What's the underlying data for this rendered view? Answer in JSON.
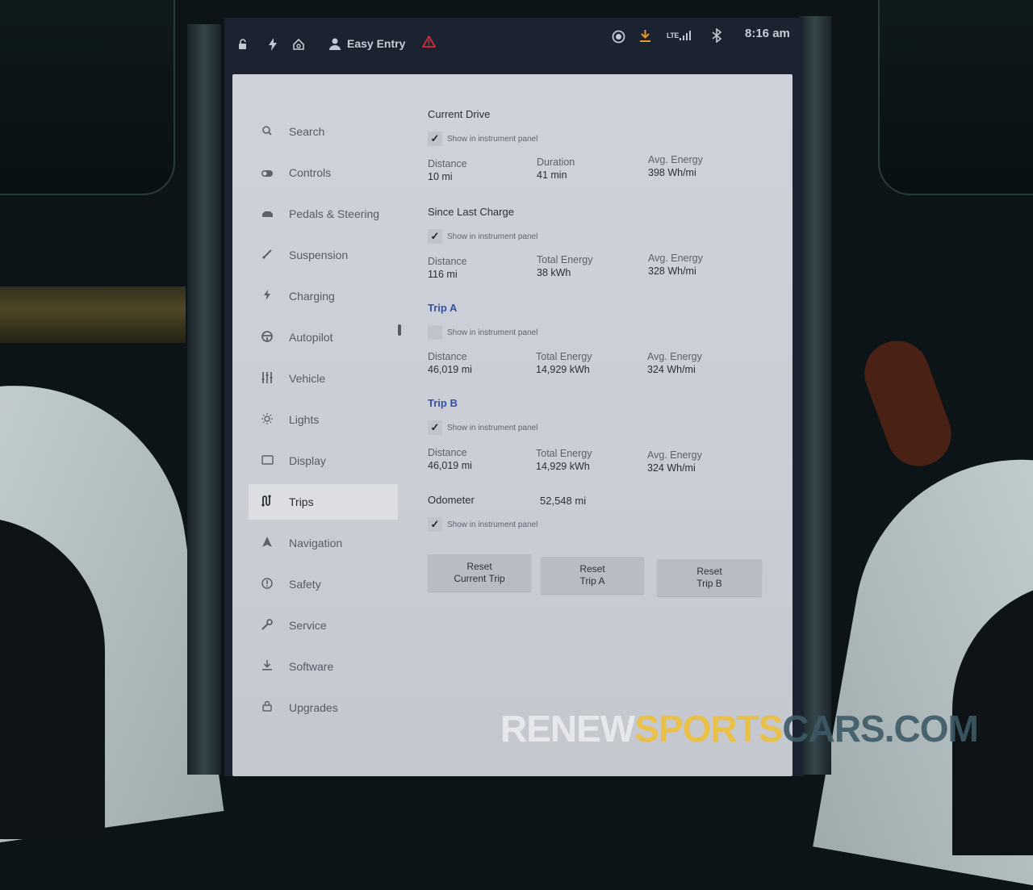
{
  "status_bar": {
    "profile_name": "Easy Entry",
    "time": "8:16 am",
    "network": "LTE",
    "icons": [
      "lock-open-icon",
      "lightning-icon",
      "homelink-icon",
      "person-icon",
      "warning-icon",
      "camera-record-icon",
      "download-icon",
      "lte-signal-icon",
      "bluetooth-icon"
    ]
  },
  "sidebar": {
    "items": [
      {
        "label": "Search",
        "icon": "search-icon"
      },
      {
        "label": "Controls",
        "icon": "toggle-icon"
      },
      {
        "label": "Pedals & Steering",
        "icon": "car-icon"
      },
      {
        "label": "Suspension",
        "icon": "suspension-icon"
      },
      {
        "label": "Charging",
        "icon": "lightning-icon"
      },
      {
        "label": "Autopilot",
        "icon": "steering-wheel-icon"
      },
      {
        "label": "Vehicle",
        "icon": "sliders-icon"
      },
      {
        "label": "Lights",
        "icon": "sun-icon"
      },
      {
        "label": "Display",
        "icon": "display-icon"
      },
      {
        "label": "Trips",
        "icon": "trips-icon"
      },
      {
        "label": "Navigation",
        "icon": "navigation-icon"
      },
      {
        "label": "Safety",
        "icon": "alert-circle-icon"
      },
      {
        "label": "Service",
        "icon": "wrench-icon"
      },
      {
        "label": "Software",
        "icon": "download-icon"
      },
      {
        "label": "Upgrades",
        "icon": "bag-icon"
      }
    ],
    "active": "Trips"
  },
  "trips": {
    "show_in_panel_label": "Show in instrument panel",
    "current_drive": {
      "title": "Current Drive",
      "show_in_panel": true,
      "stats": [
        {
          "label": "Distance",
          "value": "10 mi"
        },
        {
          "label": "Duration",
          "value": "41 min"
        },
        {
          "label": "Avg. Energy",
          "value": "398 Wh/mi"
        }
      ]
    },
    "since_last_charge": {
      "title": "Since Last Charge",
      "show_in_panel": true,
      "stats": [
        {
          "label": "Distance",
          "value": "116 mi"
        },
        {
          "label": "Total Energy",
          "value": "38 kWh"
        },
        {
          "label": "Avg. Energy",
          "value": "328 Wh/mi"
        }
      ]
    },
    "trip_a": {
      "title": "Trip A",
      "show_in_panel": false,
      "stats": [
        {
          "label": "Distance",
          "value": "46,019 mi"
        },
        {
          "label": "Total Energy",
          "value": "14,929 kWh"
        },
        {
          "label": "Avg. Energy",
          "value": "324 Wh/mi"
        }
      ]
    },
    "trip_b": {
      "title": "Trip B",
      "show_in_panel": true,
      "stats": [
        {
          "label": "Distance",
          "value": "46,019 mi"
        },
        {
          "label": "Total Energy",
          "value": "14,929 kWh"
        },
        {
          "label": "Avg. Energy",
          "value": "324 Wh/mi"
        }
      ]
    },
    "odometer": {
      "label": "Odometer",
      "value": "52,548 mi",
      "show_in_panel": true
    },
    "buttons": [
      {
        "line1": "Reset",
        "line2": "Current Trip"
      },
      {
        "line1": "Reset",
        "line2": "Trip A"
      },
      {
        "line1": "Reset",
        "line2": "Trip B"
      }
    ]
  },
  "watermark": {
    "part1": "RENEW",
    "part2": "SPORTS",
    "part3": "CARS.COM"
  },
  "colors": {
    "accent_link": "#3351a8",
    "warning": "#d72a3a",
    "download": "#e39a2a"
  }
}
